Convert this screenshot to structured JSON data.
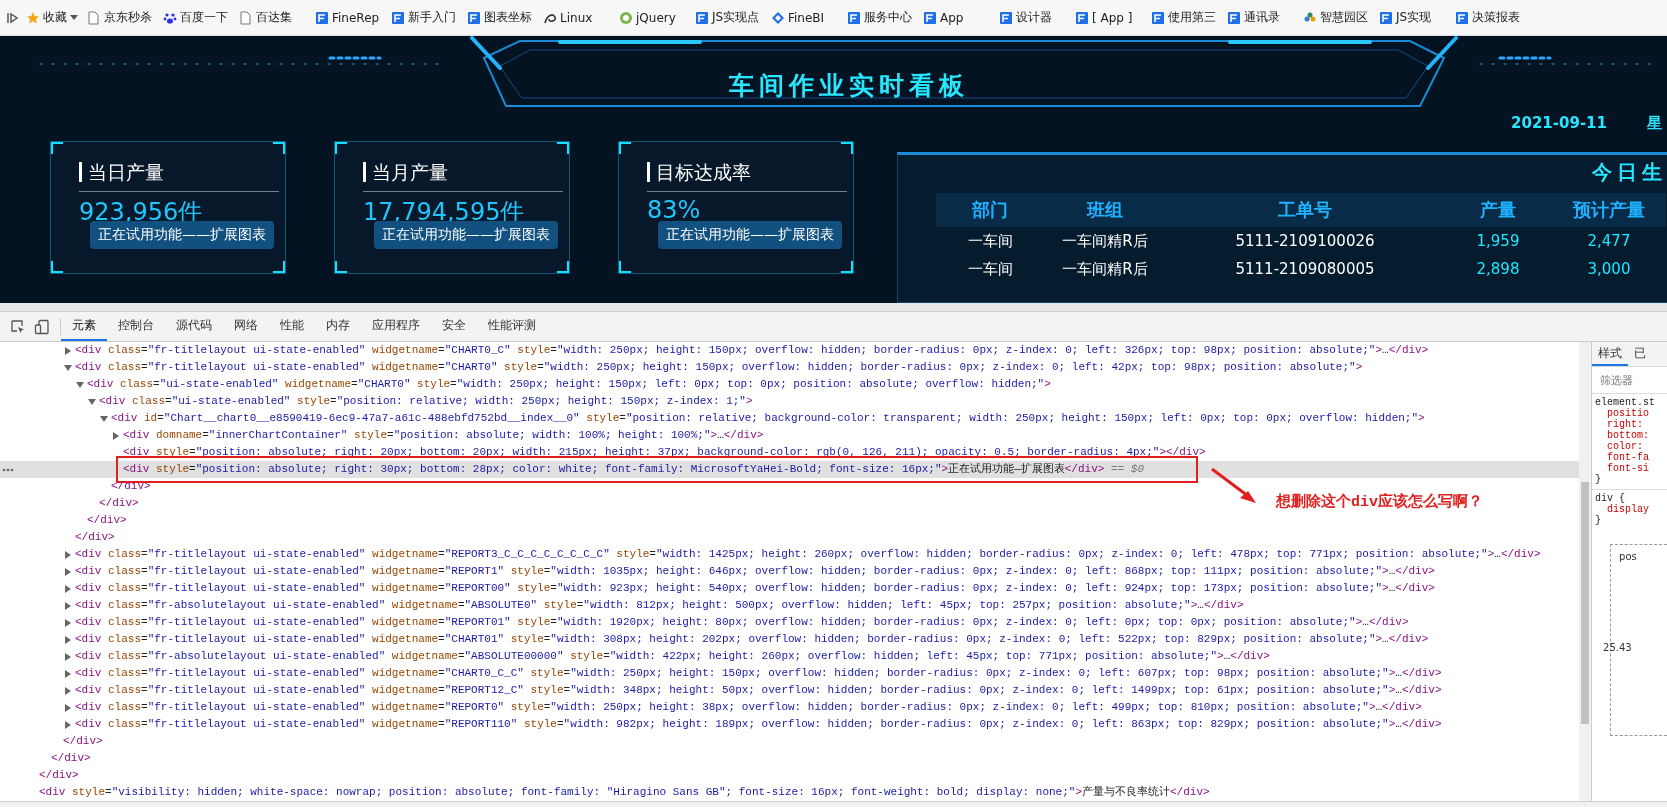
{
  "bookmarks_bar": {
    "favorites": {
      "label": "收藏"
    },
    "items": [
      {
        "label": "京东秒杀",
        "kind": "page"
      },
      {
        "label": "百度一下",
        "kind": "paw"
      },
      {
        "label": "百达集",
        "kind": "page"
      },
      {
        "label": "FineRep",
        "kind": "tile"
      },
      {
        "label": "新手入门",
        "kind": "tile"
      },
      {
        "label": "图表坐标",
        "kind": "tile"
      },
      {
        "label": "Linux",
        "kind": "swirl"
      },
      {
        "label": "jQuery",
        "kind": "circle"
      },
      {
        "label": "JS实现点",
        "kind": "tile"
      },
      {
        "label": "FineBI",
        "kind": "diamond"
      },
      {
        "label": "服务中心",
        "kind": "tile"
      },
      {
        "label": "App",
        "kind": "tile"
      },
      {
        "label": "设计器",
        "kind": "tile"
      },
      {
        "label": "[ App ]",
        "kind": "tile"
      },
      {
        "label": "使用第三",
        "kind": "tile"
      },
      {
        "label": "通讯录",
        "kind": "tile"
      },
      {
        "label": "智慧园区",
        "kind": "flower"
      },
      {
        "label": "JS实现",
        "kind": "tile"
      },
      {
        "label": "决策报表",
        "kind": "tile"
      }
    ]
  },
  "dashboard": {
    "title": "车间作业实时看板",
    "date": "2021-09-11",
    "weekday": "星",
    "cards": [
      {
        "label": "当日产量",
        "value": "923,956件",
        "badge": "正在试用功能——扩展图表"
      },
      {
        "label": "当月产量",
        "value": "17,794,595件",
        "badge": "正在试用功能——扩展图表"
      },
      {
        "label": "目标达成率",
        "value": "83%",
        "badge": "正在试用功能——扩展图表"
      }
    ],
    "table": {
      "title": "今日生",
      "columns": [
        "部门",
        "班组",
        "工单号",
        "产量",
        "预计产量"
      ],
      "rows": [
        [
          "一车间",
          "一车间精R后",
          "5111-2109100026",
          "1,959",
          "2,477"
        ],
        [
          "一车间",
          "一车间精R后",
          "5111-2109080005",
          "2,898",
          "3,000"
        ]
      ]
    }
  },
  "devtools": {
    "tabs": [
      {
        "label": "元素",
        "selected": true
      },
      {
        "label": "控制台",
        "selected": false
      },
      {
        "label": "源代码",
        "selected": false
      },
      {
        "label": "网络",
        "selected": false
      },
      {
        "label": "性能",
        "selected": false
      },
      {
        "label": "内存",
        "selected": false
      },
      {
        "label": "应用程序",
        "selected": false
      },
      {
        "label": "安全",
        "selected": false
      },
      {
        "label": "性能评测",
        "selected": false
      }
    ],
    "dom_tree": [
      {
        "children": [
          {
            "children": [
              {
                "children": [
                  {
                    "code": "<div class=\"fr-titlelayout ui-state-enabled\" widgetname=\"CHART0_C\" style=\"width: 250px; height: 150px; overflow: hidden; border-radius: 0px; z-index: 0; left: 326px; top: 98px; position: absolute;\">…</div>",
                    "expanded": false,
                    "selected": false
                  },
                  {
                    "code": "<div class=\"fr-titlelayout ui-state-enabled\" widgetname=\"CHART0\" style=\"width: 250px; height: 150px; overflow: hidden; border-radius: 0px; z-index: 0; left: 42px; top: 98px; position: absolute;\">",
                    "expanded": true,
                    "selected": false,
                    "close": "</div>",
                    "children": [
                      {
                        "code": "<div class=\"ui-state-enabled\" widgetname=\"CHART0\" style=\"width: 250px; height: 150px; left: 0px; top: 0px; position: absolute; overflow: hidden;\">",
                        "expanded": true,
                        "selected": false,
                        "close": "</div>",
                        "children": [
                          {
                            "code": "<div class=\"ui-state-enabled\" style=\"position: relative; width: 250px; height: 150px; z-index: 1;\">",
                            "expanded": true,
                            "selected": false,
                            "close": "</div>",
                            "children": [
                              {
                                "code": "<div id=\"Chart__chart0__e8590419-6ec9-47a7-a61c-488ebfd752bd__index__0\" style=\"position: relative; background-color: transparent; width: 250px; height: 150px; left: 0px; top: 0px; overflow: hidden;\">",
                                "expanded": true,
                                "selected": false,
                                "close": "</div>",
                                "children": [
                                  {
                                    "code": "<div domname=\"innerChartContainer\" style=\"position: absolute; width: 100%; height: 100%;\">…</div>",
                                    "expanded": false,
                                    "selected": false
                                  },
                                  {
                                    "code": "<div style=\"position: absolute; right: 20px; bottom: 20px; width: 215px; height: 37px; background-color: rgb(0, 126, 211); opacity: 0.5; border-radius: 4px;\"></div>",
                                    "selected": false
                                  },
                                  {
                                    "code": "<div style=\"position: absolute; right: 30px; bottom: 28px; color: white; font-family: MicrosoftYaHei-Bold; font-size: 16px;\">正在试用功能—扩展图表</div>",
                                    "selected": true,
                                    "console_ref": "== $0"
                                  }
                                ]
                              }
                            ]
                          }
                        ]
                      }
                    ]
                  },
                  {
                    "code": "<div class=\"fr-titlelayout ui-state-enabled\" widgetname=\"REPORT3_C_C_C_C_C_C_C_C\" style=\"width: 1425px; height: 260px; overflow: hidden; border-radius: 0px; z-index: 0; left: 478px; top: 771px; position: absolute;\">…</div>",
                    "expanded": false,
                    "selected": false
                  },
                  {
                    "code": "<div class=\"fr-titlelayout ui-state-enabled\" widgetname=\"REPORT1\" style=\"width: 1035px; height: 646px; overflow: hidden; border-radius: 0px; z-index: 0; left: 868px; top: 111px; position: absolute;\">…</div>",
                    "expanded": false,
                    "selected": false
                  },
                  {
                    "code": "<div class=\"fr-titlelayout ui-state-enabled\" widgetname=\"REPORT00\" style=\"width: 923px; height: 540px; overflow: hidden; border-radius: 0px; z-index: 0; left: 924px; top: 173px; position: absolute;\">…</div>",
                    "expanded": false,
                    "selected": false
                  },
                  {
                    "code": "<div class=\"fr-absolutelayout ui-state-enabled\" widgetname=\"ABSOLUTE0\" style=\"width: 812px; height: 500px; overflow: hidden; left: 45px; top: 257px; position: absolute;\">…</div>",
                    "expanded": false,
                    "selected": false
                  },
                  {
                    "code": "<div class=\"fr-titlelayout ui-state-enabled\" widgetname=\"REPORT01\" style=\"width: 1920px; height: 80px; overflow: hidden; border-radius: 0px; z-index: 0; left: 0px; top: 0px; position: absolute;\">…</div>",
                    "expanded": false,
                    "selected": false
                  },
                  {
                    "code": "<div class=\"fr-titlelayout ui-state-enabled\" widgetname=\"CHART01\" style=\"width: 308px; height: 202px; overflow: hidden; border-radius: 0px; z-index: 0; left: 522px; top: 829px; position: absolute;\">…</div>",
                    "expanded": false,
                    "selected": false
                  },
                  {
                    "code": "<div class=\"fr-absolutelayout ui-state-enabled\" widgetname=\"ABSOLUTE00000\" style=\"width: 422px; height: 260px; overflow: hidden; left: 45px; top: 771px; position: absolute;\">…</div>",
                    "expanded": false,
                    "selected": false
                  },
                  {
                    "code": "<div class=\"fr-titlelayout ui-state-enabled\" widgetname=\"CHART0_C_C\" style=\"width: 250px; height: 150px; overflow: hidden; border-radius: 0px; z-index: 0; left: 607px; top: 98px; position: absolute;\">…</div>",
                    "expanded": false,
                    "selected": false
                  },
                  {
                    "code": "<div class=\"fr-titlelayout ui-state-enabled\" widgetname=\"REPORT12_C\" style=\"width: 348px; height: 50px; overflow: hidden; border-radius: 0px; z-index: 0; left: 1499px; top: 61px; position: absolute;\">…</div>",
                    "expanded": false,
                    "selected": false
                  },
                  {
                    "code": "<div class=\"fr-titlelayout ui-state-enabled\" widgetname=\"REPORT0\" style=\"width: 250px; height: 38px; overflow: hidden; border-radius: 0px; z-index: 0; left: 499px; top: 810px; position: absolute;\">…</div>",
                    "expanded": false,
                    "selected": false
                  },
                  {
                    "code": "<div class=\"fr-titlelayout ui-state-enabled\" widgetname=\"REPORT110\" style=\"width: 982px; height: 189px; overflow: hidden; border-radius: 0px; z-index: 0; left: 863px; top: 829px; position: absolute;\">…</div>",
                    "expanded": false,
                    "selected": false
                  }
                ],
                "close": "</div>"
              }
            ],
            "close": "</div>"
          }
        ],
        "close": "</div>"
      },
      {
        "code": "<div style=\"visibility: hidden; white-space: nowrap; position: absolute; font-family: \"Hiragino Sans GB\"; font-size: 16px; font-weight: bold; display: none;\">产量与不良率统计</div>",
        "selected": false
      }
    ],
    "annotation": {
      "text": "想删除这个div应该怎么写啊？"
    },
    "styles_panel": {
      "tabs": [
        {
          "label": "样式",
          "selected": true
        },
        {
          "label": "已",
          "selected": false
        }
      ],
      "filter": {
        "placeholder": "筛选器"
      },
      "rules": [
        {
          "selector": "element.st",
          "properties": [
            "positio",
            "right:",
            "bottom:",
            "color:",
            "font-fa",
            "font-si"
          ],
          "close": "}"
        },
        {
          "selector": "div {",
          "properties": [
            "display"
          ],
          "close": "}"
        }
      ],
      "box_model": [
        "pos",
        "25.43"
      ]
    }
  }
}
